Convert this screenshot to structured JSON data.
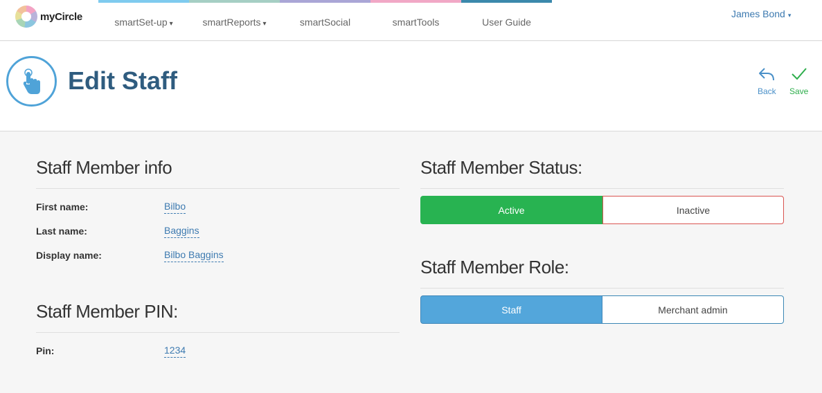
{
  "app": {
    "logo_text": "myCircle"
  },
  "nav": {
    "items": [
      {
        "label": "smartSet-up",
        "has_dropdown": true,
        "stripe_color": "#7fcbef"
      },
      {
        "label": "smartReports",
        "has_dropdown": true,
        "stripe_color": "#a6cfc4"
      },
      {
        "label": "smartSocial",
        "has_dropdown": false,
        "stripe_color": "#aaa6d6"
      },
      {
        "label": "smartTools",
        "has_dropdown": false,
        "stripe_color": "#f1a8c6"
      },
      {
        "label": "User Guide",
        "has_dropdown": false,
        "stripe_color": "#3b89ac"
      }
    ],
    "caret": "▾"
  },
  "user": {
    "name": "James Bond",
    "caret": "▾"
  },
  "header": {
    "title": "Edit Staff",
    "icon": "pointing-hand-icon",
    "back_label": "Back",
    "save_label": "Save"
  },
  "staff_info": {
    "title": "Staff Member info",
    "fields": [
      {
        "label": "First name:",
        "value": "Bilbo"
      },
      {
        "label": "Last name:",
        "value": "Baggins"
      },
      {
        "label": "Display name:",
        "value": "Bilbo Baggins"
      }
    ]
  },
  "pin_section": {
    "title": "Staff Member PIN:",
    "label": "Pin:",
    "value": "1234"
  },
  "status_section": {
    "title": "Staff Member Status:",
    "options": [
      "Active",
      "Inactive"
    ],
    "selected": "Active"
  },
  "role_section": {
    "title": "Staff Member Role:",
    "options": [
      "Staff",
      "Merchant admin"
    ],
    "selected": "Staff"
  },
  "colors": {
    "accent_blue": "#53a6db",
    "active_green": "#28b351",
    "title_blue": "#2f5c7f",
    "link_blue": "#3d7ab0",
    "inactive_border": "#d9534f"
  }
}
